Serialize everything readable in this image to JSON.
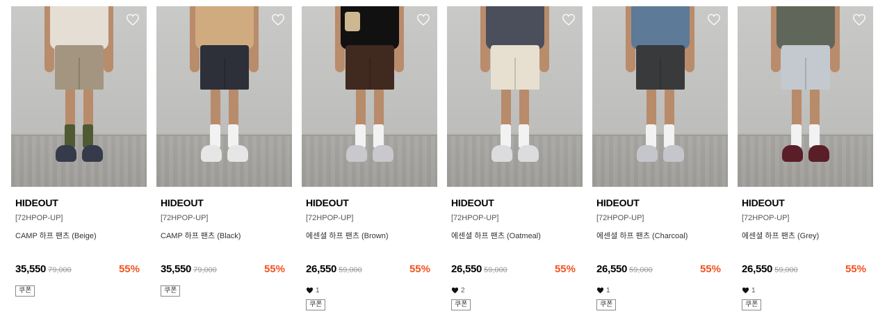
{
  "products": [
    {
      "brand": "HIDEOUT",
      "tag": "[72HPOP-UP]",
      "name": "CAMP 하프 팬츠 (Beige)",
      "price": "35,550",
      "original_price": "79,000",
      "discount": "55%",
      "likes": null,
      "coupon": "쿠폰",
      "colors": {
        "top": "#e4ded4",
        "shorts": "#a39580",
        "socks": "#4f5a33",
        "shoes": "#353b4a"
      }
    },
    {
      "brand": "HIDEOUT",
      "tag": "[72HPOP-UP]",
      "name": "CAMP 하프 팬츠 (Black)",
      "price": "35,550",
      "original_price": "79,000",
      "discount": "55%",
      "likes": null,
      "coupon": "쿠폰",
      "colors": {
        "top": "#d1ab80",
        "shorts": "#2d3038",
        "socks": "#f2f2f2",
        "shoes": "#e6e6e6"
      }
    },
    {
      "brand": "HIDEOUT",
      "tag": "[72HPOP-UP]",
      "name": "에센셜 하프 팬츠 (Brown)",
      "price": "26,550",
      "original_price": "59,000",
      "discount": "55%",
      "likes": "1",
      "coupon": "쿠폰",
      "colors": {
        "top": "#111111",
        "shorts": "#40291e",
        "socks": "#f2f2f2",
        "shoes": "#c9c9cd"
      }
    },
    {
      "brand": "HIDEOUT",
      "tag": "[72HPOP-UP]",
      "name": "에센셜 하프 팬츠 (Oatmeal)",
      "price": "26,550",
      "original_price": "59,000",
      "discount": "55%",
      "likes": "2",
      "coupon": "쿠폰",
      "colors": {
        "top": "#4b4f5c",
        "shorts": "#e7e0d0",
        "socks": "#f2f2f2",
        "shoes": "#dcdcde"
      }
    },
    {
      "brand": "HIDEOUT",
      "tag": "[72HPOP-UP]",
      "name": "에센셜 하프 팬츠 (Charcoal)",
      "price": "26,550",
      "original_price": "59,000",
      "discount": "55%",
      "likes": "1",
      "coupon": "쿠폰",
      "colors": {
        "top": "#5d7a99",
        "shorts": "#383a3c",
        "socks": "#f2f2f2",
        "shoes": "#c5c6cb"
      }
    },
    {
      "brand": "HIDEOUT",
      "tag": "[72HPOP-UP]",
      "name": "에센셜 하프 팬츠 (Grey)",
      "price": "26,550",
      "original_price": "59,000",
      "discount": "55%",
      "likes": "1",
      "coupon": "쿠폰",
      "colors": {
        "top": "#61665a",
        "shorts": "#c4c9d0",
        "socks": "#f2f2f2",
        "shoes": "#5a1e28"
      }
    }
  ],
  "icons": {
    "wishlist": "heart-outline-icon",
    "likes": "heart-filled-icon"
  },
  "accent": {
    "discount": "#f4511e"
  }
}
